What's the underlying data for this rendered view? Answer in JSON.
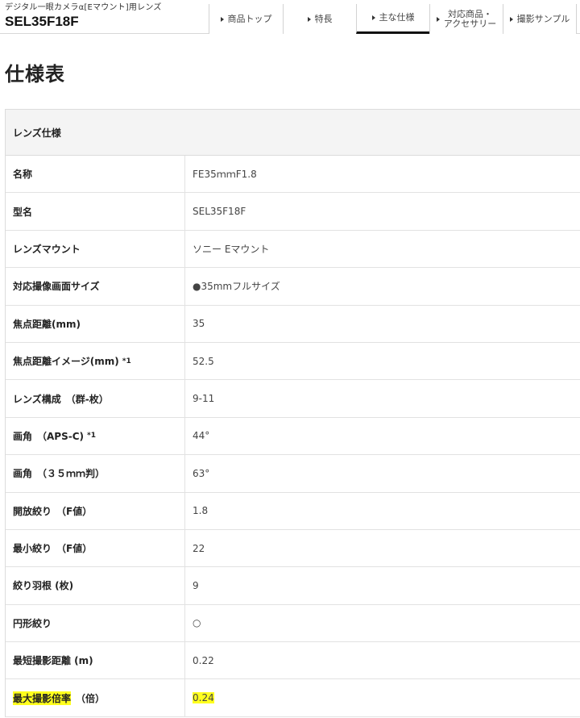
{
  "header": {
    "subtitle": "デジタル一眼カメラα[Eマウント]用レンズ",
    "model": "SEL35F18F"
  },
  "tabs": [
    {
      "label": "商品トップ",
      "active": false
    },
    {
      "label": "特長",
      "active": false
    },
    {
      "label": "主な仕様",
      "active": true
    },
    {
      "label": "対応商品・\nアクセサリー",
      "active": false
    },
    {
      "label": "撮影サンプル",
      "active": false
    }
  ],
  "page_title": "仕様表",
  "section_title": "レンズ仕様",
  "specs": [
    {
      "label": "名称",
      "value": "FE35ｍｍF1.8",
      "note": ""
    },
    {
      "label": "型名",
      "value": "SEL35F18F",
      "note": ""
    },
    {
      "label": "レンズマウント",
      "value": "ソニー Eマウント",
      "note": ""
    },
    {
      "label": "対応撮像画面サイズ",
      "value": "●35mmフルサイズ",
      "note": ""
    },
    {
      "label": "焦点距離(mm)",
      "value": "35",
      "note": ""
    },
    {
      "label": "焦点距離イメージ(mm)",
      "value": "52.5",
      "note": "*1"
    },
    {
      "label": "レンズ構成　（群-枚）",
      "value": "9-11",
      "note": ""
    },
    {
      "label": "画角　（APS-C)",
      "value": "44°",
      "note": "*1"
    },
    {
      "label": "画角　（３５ｍｍ判）",
      "value": "63°",
      "note": ""
    },
    {
      "label": "開放絞り　（F値）",
      "value": "1.8",
      "note": ""
    },
    {
      "label": "最小絞り　（F値）",
      "value": "22",
      "note": ""
    },
    {
      "label": "絞り羽根 (枚)",
      "value": "9",
      "note": ""
    },
    {
      "label": "円形絞り",
      "value": "○",
      "note": ""
    },
    {
      "label": "最短撮影距離 (m)",
      "value": "0.22",
      "note": ""
    },
    {
      "label_main": "最大撮影倍率",
      "label_rest": "　（倍）",
      "value": "0.24",
      "note": ""
    }
  ],
  "colors": {
    "highlight": "#ffff1e",
    "active_tab_underline": "#111111",
    "section_bg": "#f4f4f4"
  }
}
